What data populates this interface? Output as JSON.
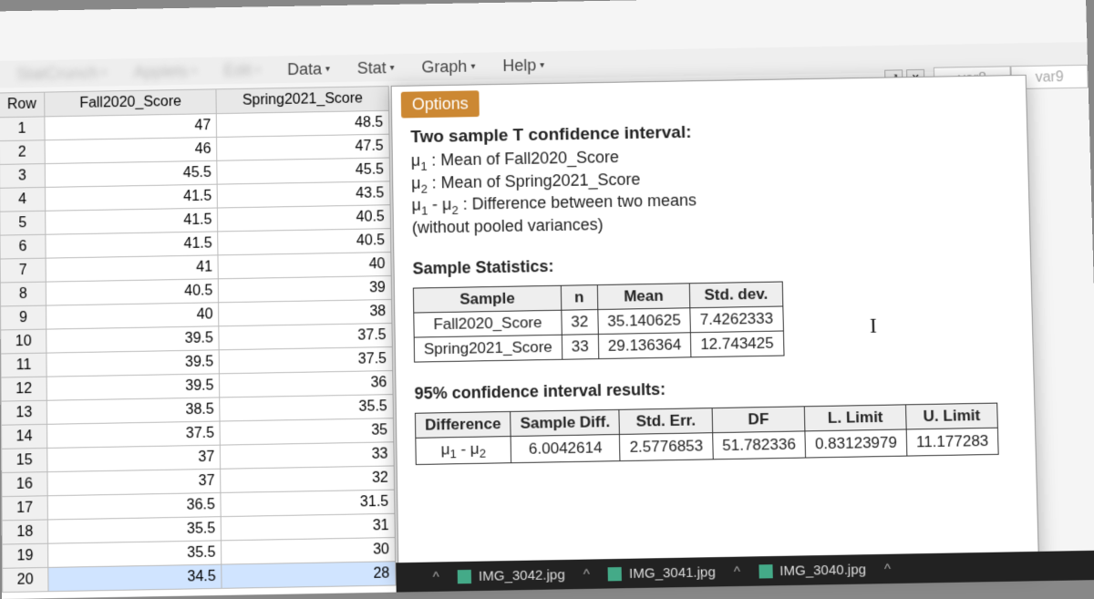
{
  "menubar": {
    "items": [
      "StatCrunch",
      "Applets",
      "Edit",
      "Data",
      "Stat",
      "Graph",
      "Help"
    ]
  },
  "columns": {
    "row": "Row",
    "c1": "Fall2020_Score",
    "c2": "Spring2021_Score"
  },
  "rows": [
    {
      "n": 1,
      "a": "47",
      "b": "48.5"
    },
    {
      "n": 2,
      "a": "46",
      "b": "47.5"
    },
    {
      "n": 3,
      "a": "45.5",
      "b": "45.5"
    },
    {
      "n": 4,
      "a": "41.5",
      "b": "43.5"
    },
    {
      "n": 5,
      "a": "41.5",
      "b": "40.5"
    },
    {
      "n": 6,
      "a": "41.5",
      "b": "40.5"
    },
    {
      "n": 7,
      "a": "41",
      "b": "40"
    },
    {
      "n": 8,
      "a": "40.5",
      "b": "39"
    },
    {
      "n": 9,
      "a": "40",
      "b": "38"
    },
    {
      "n": 10,
      "a": "39.5",
      "b": "37.5"
    },
    {
      "n": 11,
      "a": "39.5",
      "b": "37.5"
    },
    {
      "n": 12,
      "a": "39.5",
      "b": "36"
    },
    {
      "n": 13,
      "a": "38.5",
      "b": "35.5"
    },
    {
      "n": 14,
      "a": "37.5",
      "b": "35"
    },
    {
      "n": 15,
      "a": "37",
      "b": "33"
    },
    {
      "n": 16,
      "a": "37",
      "b": "32"
    },
    {
      "n": 17,
      "a": "36.5",
      "b": "31.5"
    },
    {
      "n": 18,
      "a": "35.5",
      "b": "31"
    },
    {
      "n": 19,
      "a": "35.5",
      "b": "30"
    },
    {
      "n": 20,
      "a": "34.5",
      "b": "28"
    }
  ],
  "extra_cols": [
    "var8",
    "var9"
  ],
  "panel": {
    "options": "Options",
    "title": "Two sample T confidence interval:",
    "l1a": "μ",
    "l1b": "1",
    "l1c": " : Mean of Fall2020_Score",
    "l2a": "μ",
    "l2b": "2",
    "l2c": " : Mean of Spring2021_Score",
    "l3a": "μ",
    "l3b": "1",
    "l3c": " - μ",
    "l3d": "2",
    "l3e": " : Difference between two means",
    "l4": "(without pooled variances)",
    "stats_title": "Sample Statistics:",
    "stats_head": [
      "Sample",
      "n",
      "Mean",
      "Std. dev."
    ],
    "stats_rows": [
      [
        "Fall2020_Score",
        "32",
        "35.140625",
        "7.4262333"
      ],
      [
        "Spring2021_Score",
        "33",
        "29.136364",
        "12.743425"
      ]
    ],
    "ci_title": "95% confidence interval results:",
    "ci_head": [
      "Difference",
      "Sample Diff.",
      "Std. Err.",
      "DF",
      "L. Limit",
      "U. Limit"
    ],
    "ci_row_label_a": "μ",
    "ci_row_label_b": "1",
    "ci_row_label_c": " - μ",
    "ci_row_label_d": "2",
    "ci_row": [
      "6.0042614",
      "2.5776853",
      "51.782336",
      "0.83123979",
      "11.177283"
    ]
  },
  "chart_data": {
    "type": "table",
    "title": "Two sample T confidence interval",
    "sample_statistics": {
      "Fall2020_Score": {
        "n": 32,
        "mean": 35.140625,
        "std_dev": 7.4262333
      },
      "Spring2021_Score": {
        "n": 33,
        "mean": 29.136364,
        "std_dev": 12.743425
      }
    },
    "confidence_interval": {
      "level": 0.95,
      "difference": "mu1 - mu2",
      "sample_diff": 6.0042614,
      "std_err": 2.5776853,
      "df": 51.782336,
      "lower": 0.83123979,
      "upper": 11.177283
    }
  },
  "taskbar": {
    "items": [
      "IMG_3042.jpg",
      "IMG_3041.jpg",
      "IMG_3040.jpg"
    ]
  },
  "cursor_glyph": "I"
}
